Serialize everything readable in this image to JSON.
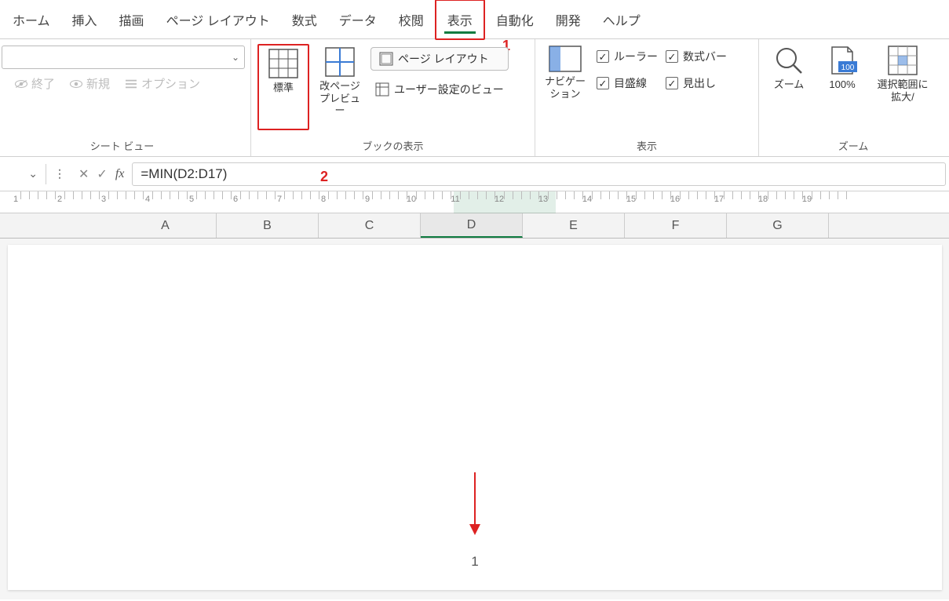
{
  "menu": {
    "items": [
      "ホーム",
      "挿入",
      "描画",
      "ページ レイアウト",
      "数式",
      "データ",
      "校閲",
      "表示",
      "自動化",
      "開発",
      "ヘルプ"
    ],
    "active_index": 7
  },
  "annotations": {
    "one": "1",
    "two": "2"
  },
  "ribbon": {
    "group1": {
      "label": "シート ビュー",
      "end": "終了",
      "new": "新規",
      "options": "オプション"
    },
    "group2": {
      "label": "ブックの表示",
      "standard": "標準",
      "pagebreak": "改ページ\nプレビュー",
      "pagelayout": "ページ レイアウト",
      "customview": "ユーザー設定のビュー"
    },
    "group3": {
      "label": "表示",
      "navigation": "ナビゲー\nション",
      "ruler": "ルーラー",
      "formulabar": "数式バー",
      "gridlines": "目盛線",
      "headings": "見出し"
    },
    "group4": {
      "label": "ズーム",
      "zoom": "ズーム",
      "hundred": "100%",
      "selection": "選択範囲に\n拡大/"
    }
  },
  "formula": {
    "value": "=MIN(D2:D17)"
  },
  "ruler_numbers": [
    1,
    2,
    3,
    4,
    5,
    6,
    7,
    8,
    9,
    10,
    11,
    12,
    13,
    14,
    15,
    16,
    17,
    18,
    19
  ],
  "columns": [
    "A",
    "B",
    "C",
    "D",
    "E",
    "F",
    "G"
  ],
  "active_column_index": 3,
  "page_number": "1"
}
